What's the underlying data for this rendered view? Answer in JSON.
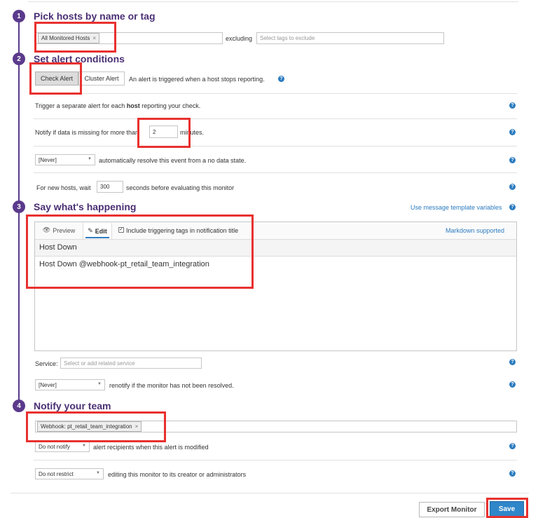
{
  "steps": [
    {
      "number": "1",
      "title": "Pick hosts by name or tag"
    },
    {
      "number": "2",
      "title": "Set alert conditions"
    },
    {
      "number": "3",
      "title": "Say what's happening"
    },
    {
      "number": "4",
      "title": "Notify your team"
    }
  ],
  "hosts": {
    "tag": "All Monitored Hosts",
    "excluding_label": "excluding",
    "exclude_placeholder": "Select tags to exclude"
  },
  "alert": {
    "check_alert": "Check Alert",
    "cluster_alert": "Cluster Alert",
    "trigger_desc": "An alert is triggered when a host stops reporting.",
    "separate_pre": "Trigger a separate alert for each ",
    "separate_bold": "host",
    "separate_post": " reporting your check.",
    "missing_pre": "Notify if data is missing for more than",
    "missing_value": "2",
    "missing_post": "minutes.",
    "resolve_select": "[Never]",
    "resolve_text": "automatically resolve this event from a no data state.",
    "newhost_pre": "For new hosts, wait",
    "newhost_value": "300",
    "newhost_post": "seconds before evaluating this monitor"
  },
  "message": {
    "template_link": "Use message template variables",
    "tab_preview": "Preview",
    "tab_edit": "Edit",
    "include_tags": "Include triggering tags in notification title",
    "markdown": "Markdown supported",
    "title_value": "Host Down",
    "body_value": "Host Down @webhook-pt_retail_team_integration",
    "service_label": "Service:",
    "service_placeholder": "Select or add related service",
    "renotify_select": "[Never]",
    "renotify_text": "renotify if the monitor has not been resolved."
  },
  "notify": {
    "recipient_tag": "Webhook: pt_retail_team_integration",
    "modify_select": "Do not notify",
    "modify_text": "alert recipients when this alert is modified",
    "restrict_select": "Do not restrict",
    "restrict_text": "editing this monitor to its creator or administrators"
  },
  "footer": {
    "export": "Export Monitor",
    "save": "Save"
  },
  "colors": {
    "accent": "#5b3a8c",
    "link": "#2c7bbf",
    "highlight": "#e8312f",
    "save": "#2f86c9"
  }
}
